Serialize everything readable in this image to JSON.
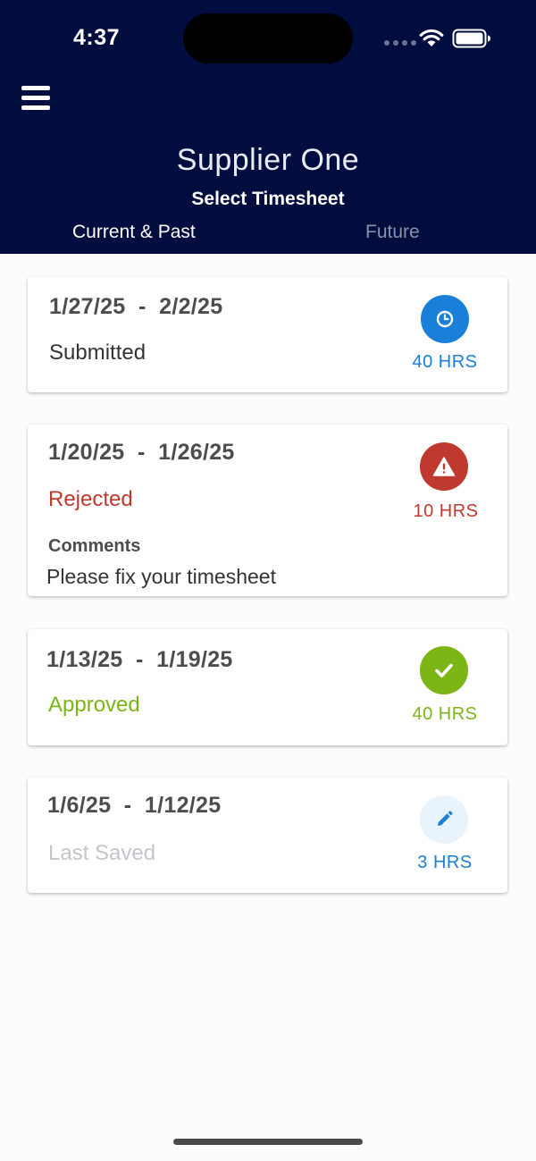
{
  "status_bar": {
    "time": "4:37"
  },
  "header": {
    "supplier_name": "Supplier One",
    "title": "Select Timesheet",
    "tabs": [
      {
        "label": "Current & Past",
        "active": true
      },
      {
        "label": "Future",
        "active": false
      }
    ]
  },
  "colors": {
    "header_bg": "#020d3f",
    "submitted": "#1a7fd9",
    "rejected": "#c0392f",
    "approved": "#7cb616",
    "saved_text": "#c2c6cc",
    "saved_badge_bg": "#e9f3fc"
  },
  "timesheets": [
    {
      "start": "1/27/25",
      "end": "2/2/25",
      "range": "1/27/25  -  2/2/25",
      "status": "Submitted",
      "hours": "40 HRS",
      "icon": "clock-icon"
    },
    {
      "start": "1/20/25",
      "end": "1/26/25",
      "range": "1/20/25  -  1/26/25",
      "status": "Rejected",
      "hours": "10 HRS",
      "icon": "warning-icon",
      "comments_label": "Comments",
      "comments": "Please fix your timesheet"
    },
    {
      "start": "1/13/25",
      "end": "1/19/25",
      "range": "1/13/25  -  1/19/25",
      "status": "Approved",
      "hours": "40 HRS",
      "icon": "check-icon"
    },
    {
      "start": "1/6/25",
      "end": "1/12/25",
      "range": "1/6/25  -  1/12/25",
      "status": "Last Saved",
      "hours": "3 HRS",
      "icon": "pencil-icon"
    }
  ]
}
